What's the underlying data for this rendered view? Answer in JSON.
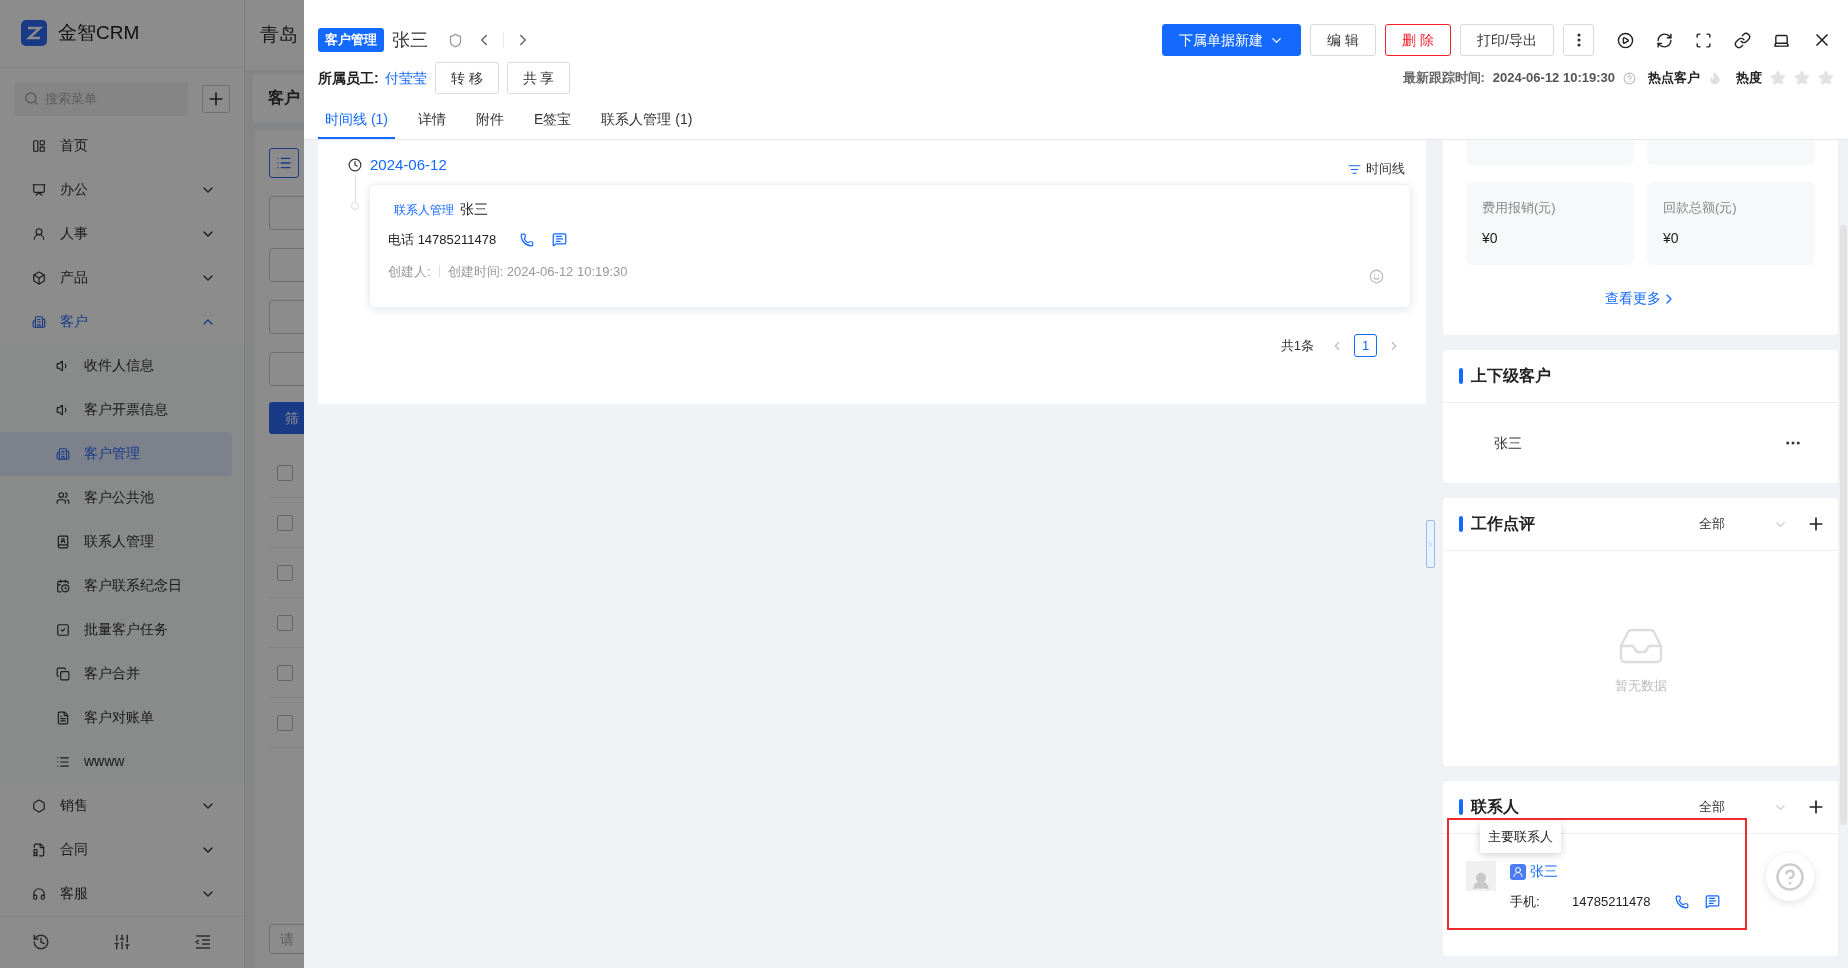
{
  "background_page": {
    "app_name": "金智CRM",
    "company_title": "青岛",
    "page_title": "客户",
    "search": {
      "placeholder": "搜索菜单"
    },
    "menu": [
      {
        "label": "首页",
        "kind": "link",
        "selected": false
      },
      {
        "label": "办公",
        "kind": "group",
        "selected": false,
        "expanded": false
      },
      {
        "label": "人事",
        "kind": "group",
        "selected": false,
        "expanded": false
      },
      {
        "label": "产品",
        "kind": "group",
        "selected": false,
        "expanded": false
      },
      {
        "label": "客户",
        "kind": "group",
        "selected": true,
        "expanded": true,
        "children": [
          {
            "label": "收件人信息",
            "selected": false
          },
          {
            "label": "客户开票信息",
            "selected": false
          },
          {
            "label": "客户管理",
            "selected": true
          },
          {
            "label": "客户公共池",
            "selected": false
          },
          {
            "label": "联系人管理",
            "selected": false
          },
          {
            "label": "客户联系纪念日",
            "selected": false
          },
          {
            "label": "批量客户任务",
            "selected": false
          },
          {
            "label": "客户合并",
            "selected": false
          },
          {
            "label": "客户对账单",
            "selected": false
          },
          {
            "label": "wwww",
            "selected": false
          }
        ]
      },
      {
        "label": "销售",
        "kind": "group",
        "selected": false,
        "expanded": false
      },
      {
        "label": "合同",
        "kind": "group",
        "selected": false,
        "expanded": false
      },
      {
        "label": "客服",
        "kind": "group",
        "selected": false,
        "expanded": false
      }
    ],
    "filter_button": "筛",
    "table_rows": [
      {
        "checked": false
      },
      {
        "checked": false
      },
      {
        "checked": false
      },
      {
        "checked": false
      },
      {
        "checked": false
      },
      {
        "checked": false
      }
    ],
    "select_placeholder": "请"
  },
  "drawer": {
    "tag": "客户管理",
    "name": "张三",
    "owner_label": "所属员工:",
    "owner": "付莹莹",
    "owner_actions": [
      "转 移",
      "共 享"
    ],
    "actions": [
      {
        "label": "下属单据新建",
        "kind": "primary"
      },
      {
        "label": "编 辑",
        "kind": "default"
      },
      {
        "label": "删 除",
        "kind": "danger"
      },
      {
        "label": "打印/导出",
        "kind": "default"
      }
    ],
    "last_follow_label": "最新跟踪时间:",
    "last_follow_time": "2024-06-12 10:19:30",
    "hot_label": "热点客户",
    "hot": false,
    "heat_label": "热度",
    "heat": {
      "stars": 0
    },
    "tabs": [
      {
        "label": "时间线 (1)",
        "selected": true
      },
      {
        "label": "详情",
        "selected": false
      },
      {
        "label": "附件",
        "selected": false
      },
      {
        "label": "E签宝",
        "selected": false
      },
      {
        "label": "联系人管理 (1)",
        "selected": false
      }
    ]
  },
  "timeline": {
    "date": "2024-06-12",
    "sort_label": "时间线",
    "entries": [
      {
        "module": "联系人管理",
        "name": "张三",
        "phone_label": "电话",
        "phone": "14785211478",
        "creator_label": "创建人:",
        "created": "创建时间: 2024-06-12 10:19:30"
      }
    ],
    "pagination": {
      "total": "共1条",
      "pages": [
        {
          "label": "1",
          "selected": true
        }
      ]
    }
  },
  "right_panel": {
    "stats": [
      {
        "label": "费用报销(元)",
        "value": "¥0"
      },
      {
        "label": "回款总额(元)",
        "value": "¥0"
      }
    ],
    "view_more": "查看更多",
    "parent_customers": {
      "title": "上下级客户",
      "items": [
        "张三"
      ]
    },
    "work_reviews": {
      "title": "工作点评",
      "filter": "全部",
      "empty_text": "暂无数据"
    },
    "contacts": {
      "title": "联系人",
      "filter": "全部",
      "tooltip": "主要联系人",
      "highlighted": true,
      "items": [
        {
          "name": "张三",
          "primary": true,
          "mobile_label": "手机:",
          "mobile": "14785211478"
        }
      ]
    }
  }
}
